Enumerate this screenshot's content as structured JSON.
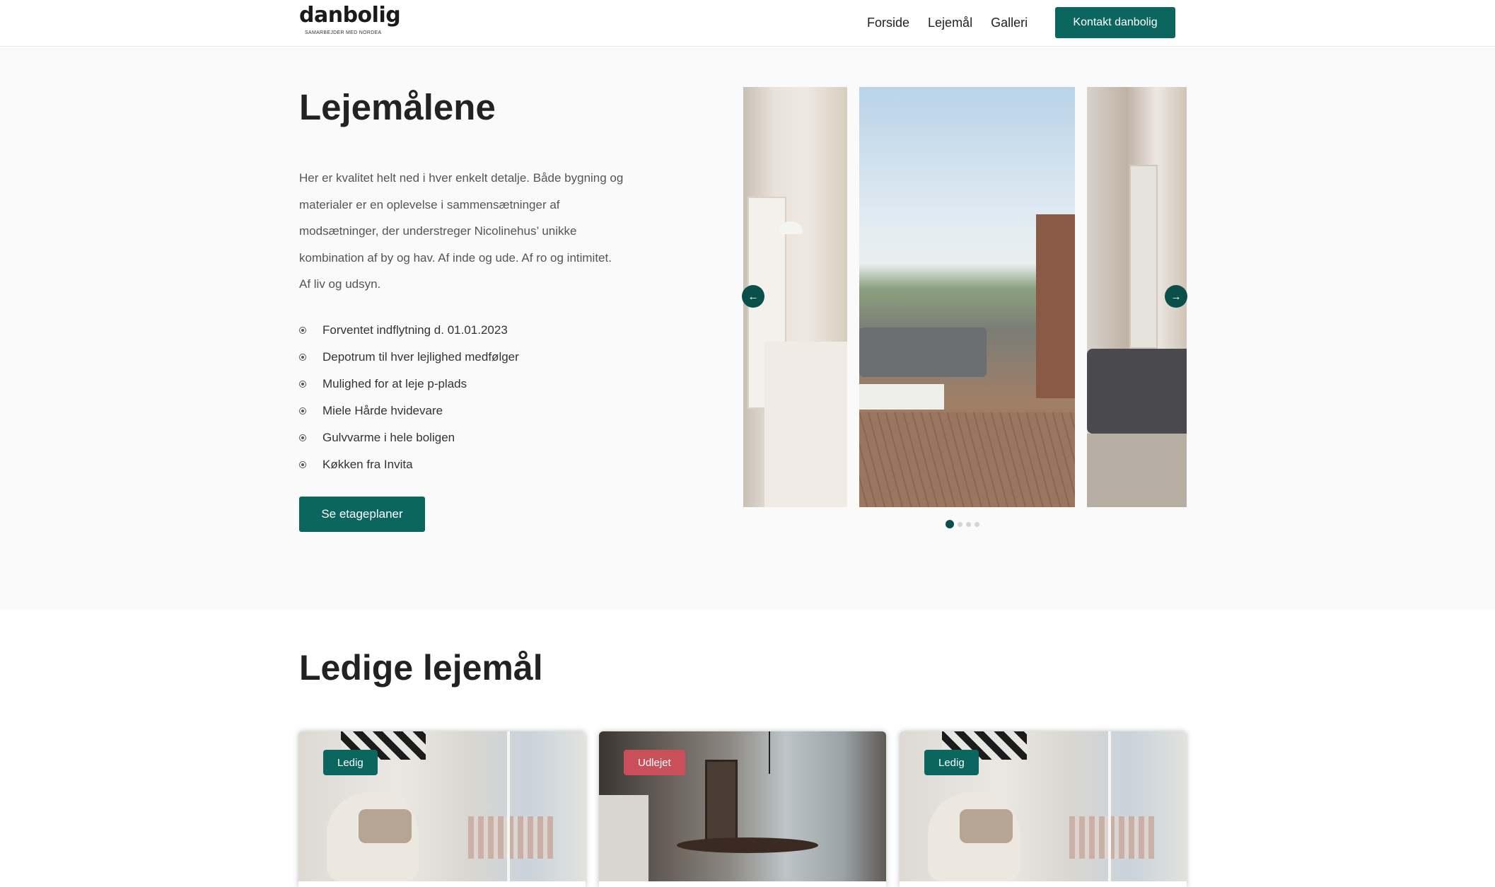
{
  "header": {
    "logo_text": "danbolig",
    "logo_subtext": "SAMARBEJDER MED NORDEA",
    "nav": [
      "Forside",
      "Lejemål",
      "Galleri"
    ],
    "contact_label": "Kontakt danbolig"
  },
  "intro": {
    "title": "Lejemålene",
    "description": "Her er kvalitet helt ned i hver enkelt detalje. Både bygning og materialer er en oplevelse i sammensætninger af modsætninger, der understreger Nicolinehus’ unikke kombination af by og hav. Af inde og ude. Af ro og intimitet. Af liv og udsyn.",
    "features": [
      "Forventet indflytning d. 01.01.2023",
      "Depotrum til hver lejlighed medfølger",
      "Mulighed for at leje p-plads",
      "Miele Hårde hvidevare",
      "Gulvvarme i hele boligen",
      "Køkken fra Invita"
    ],
    "plans_button": "Se etageplaner"
  },
  "carousel": {
    "prev_icon": "arrow-left-icon",
    "next_icon": "arrow-right-icon",
    "slide_count": 4,
    "active_index": 0
  },
  "listings": {
    "title": "Ledige lejemål",
    "cards": [
      {
        "status": "Ledig"
      },
      {
        "status": "Udlejet"
      },
      {
        "status": "Ledig"
      }
    ]
  },
  "colors": {
    "brand_green": "#0b6660",
    "dark_green": "#0b4f4b",
    "rented_red": "#c9505a"
  }
}
